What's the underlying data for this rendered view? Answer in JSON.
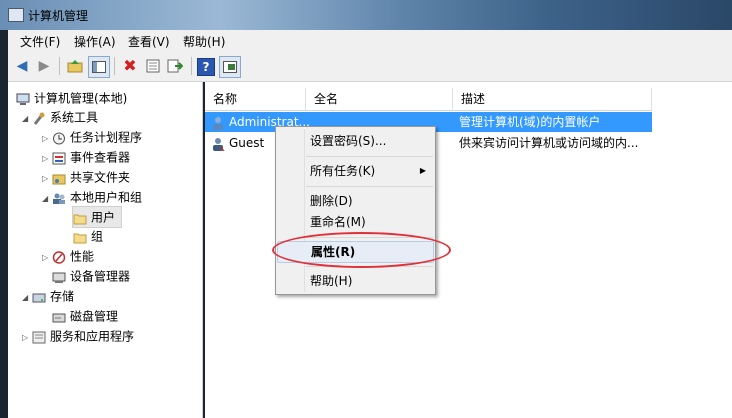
{
  "window": {
    "title": "计算机管理"
  },
  "menu": [
    {
      "label": "文件(F)"
    },
    {
      "label": "操作(A)"
    },
    {
      "label": "查看(V)"
    },
    {
      "label": "帮助(H)"
    }
  ],
  "toolbar": {
    "icons": [
      "back-arrow-icon",
      "forward-arrow-icon",
      "up-folder-icon",
      "show-hide-tree-icon",
      "delete-icon",
      "properties-icon",
      "export-list-icon",
      "help-icon",
      "console-tree-icon"
    ]
  },
  "tree": [
    {
      "label": "计算机管理(本地)",
      "level": 0,
      "arrow": ""
    },
    {
      "label": "系统工具",
      "level": 1,
      "arrow": "◢"
    },
    {
      "label": "任务计划程序",
      "level": 2,
      "arrow": "▷"
    },
    {
      "label": "事件查看器",
      "level": 2,
      "arrow": "▷"
    },
    {
      "label": "共享文件夹",
      "level": 2,
      "arrow": "▷"
    },
    {
      "label": "本地用户和组",
      "level": 2,
      "arrow": "◢"
    },
    {
      "label": "用户",
      "level": 3,
      "arrow": "",
      "selected": true
    },
    {
      "label": "组",
      "level": 3,
      "arrow": ""
    },
    {
      "label": "性能",
      "level": 2,
      "arrow": "▷"
    },
    {
      "label": "设备管理器",
      "level": 2,
      "arrow": ""
    },
    {
      "label": "存储",
      "level": 1,
      "arrow": "◢"
    },
    {
      "label": "磁盘管理",
      "level": 2,
      "arrow": ""
    },
    {
      "label": "服务和应用程序",
      "level": 1,
      "arrow": "▷"
    }
  ],
  "list": {
    "columns": [
      "名称",
      "全名",
      "描述"
    ],
    "rows": [
      {
        "name": "Administrat...",
        "fullname": "",
        "desc": "管理计算机(域)的内置帐户",
        "selected": true
      },
      {
        "name": "Guest",
        "fullname": "",
        "desc": "供来宾访问计算机或访问域的内...",
        "selected": false
      }
    ]
  },
  "context_menu": {
    "set_password": "设置密码(S)...",
    "all_tasks": "所有任务(K)",
    "delete": "删除(D)",
    "rename": "重命名(M)",
    "properties": "属性(R)",
    "help": "帮助(H)"
  },
  "colors": {
    "selection": "#3399ff",
    "annotation": "#e0303a"
  }
}
